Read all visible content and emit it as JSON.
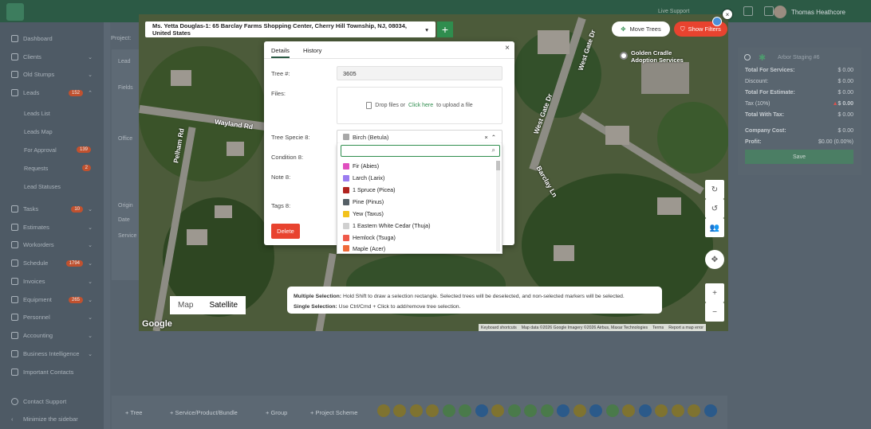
{
  "topbar": {
    "live_support": "Live Support",
    "user_name": "Thomas Heathcore"
  },
  "sidebar": {
    "items": [
      {
        "label": "Dashboard",
        "icon": "grid-icon"
      },
      {
        "label": "Clients",
        "icon": "users-icon"
      },
      {
        "label": "Old Stumps",
        "icon": "stump-icon"
      },
      {
        "label": "Leads",
        "icon": "user-add-icon",
        "badge": "152"
      },
      {
        "label": "Tasks",
        "icon": "checkbox-icon",
        "badge": "10"
      },
      {
        "label": "Estimates",
        "icon": "dollar-icon"
      },
      {
        "label": "Workorders",
        "icon": "users-icon"
      },
      {
        "label": "Schedule",
        "icon": "calendar-icon",
        "badge": "1794"
      },
      {
        "label": "Invoices",
        "icon": "dollar-icon"
      },
      {
        "label": "Equipment",
        "icon": "truck-icon",
        "badge": "265"
      },
      {
        "label": "Personnel",
        "icon": "person-icon"
      },
      {
        "label": "Accounting",
        "icon": "accounting-icon"
      },
      {
        "label": "Business Intelligence",
        "icon": "bulb-icon"
      },
      {
        "label": "Important Contacts",
        "icon": "phone-icon"
      }
    ],
    "leads_sub": [
      {
        "label": "Leads List"
      },
      {
        "label": "Leads Map"
      },
      {
        "label": "For Approval",
        "badge": "139"
      },
      {
        "label": "Requests",
        "badge": "2"
      },
      {
        "label": "Lead Statuses"
      }
    ],
    "contact_support": "Contact Support",
    "minimize": "Minimize the sidebar"
  },
  "page": {
    "project_label": "Project:",
    "lead_label": "Lead",
    "fields_label": "Fields",
    "office_label": "Office",
    "origin_label": "Origin",
    "date_label": "Date",
    "service_label": "Service"
  },
  "summary": {
    "title": "Arbor Staging #6",
    "rows": [
      {
        "label": "Total For Services:",
        "value": "$ 0.00"
      },
      {
        "label": "Discount:",
        "value": "$ 0.00"
      },
      {
        "label": "Total For Estimate:",
        "value": "$ 0.00"
      },
      {
        "label": "Tax (10%)",
        "value": "$ 0.00"
      },
      {
        "label": "Total With Tax:",
        "value": "$ 0.00"
      },
      {
        "label": "Company Cost:",
        "value": "$ 0.00"
      },
      {
        "label": "Profit:",
        "value": "$0.00 (0.00%)"
      }
    ],
    "save_label": "Save"
  },
  "bottombar": {
    "buttons": [
      {
        "label": "Tree"
      },
      {
        "label": "Service/Product/Bundle"
      },
      {
        "label": "Group"
      },
      {
        "label": "Project Scheme"
      }
    ]
  },
  "map": {
    "address": "Ms. Yetta Douglas-1: 65 Barclay Farms Shopping Center, Cherry Hill Township, NJ, 08034, United States",
    "move_trees_label": "Move Trees",
    "show_filters_label": "Show Filters",
    "labels": [
      "Wayland Rd",
      "Pelham Rd",
      "West Gate Dr",
      "West Gate Dr",
      "Barclay Ln",
      "Golden Cradle Adoption Services"
    ],
    "map_type": {
      "map_label": "Map",
      "satellite_label": "Satellite",
      "selected": "Satellite"
    },
    "hint_line1_prefix": "Multiple Selection:",
    "hint_line1": "Hold Shift to draw a selection rectangle. Selected trees will be deselected, and non-selected markers will be selected.",
    "hint_line2_prefix": "Single Selection:",
    "hint_line2": "Use Ctrl/Cmd + Click to add/remove tree selection.",
    "attribution": [
      "Keyboard shortcuts",
      "Map data ©2026 Google Imagery ©2026 Airbus, Maxar Technologies",
      "Terms",
      "Report a map error"
    ],
    "google_logo": "Google"
  },
  "dialog": {
    "tabs": [
      {
        "label": "Details"
      },
      {
        "label": "History"
      }
    ],
    "tree_number_label": "Tree #:",
    "tree_number_value": "3605",
    "files_label": "Files:",
    "drop_text": "Drop files or",
    "click_here": "Click here",
    "upload_text": "to upload a file",
    "specie_label": "Tree Specie 8:",
    "condition_label": "Condition 8:",
    "note_label": "Note 8:",
    "tags_label": "Tags 8:",
    "delete_label": "Delete",
    "selected_specie": {
      "label": "Birch (Betula)",
      "color": "#a8a8a8"
    },
    "search_value": "",
    "options": [
      {
        "label": "Fir (Abies)",
        "color": "#e04fbf"
      },
      {
        "label": "Larch (Larix)",
        "color": "#9b7cf0"
      },
      {
        "label": "1 Spruce (Picea)",
        "color": "#b0231f"
      },
      {
        "label": "Pine (Pinus)",
        "color": "#555f66"
      },
      {
        "label": "Yew (Taxus)",
        "color": "#f2c21b"
      },
      {
        "label": "1 Eastern White Cedar (Thuja)",
        "color": "#d0d0d0"
      },
      {
        "label": "Hemlock (Tsuga)",
        "color": "#ef5a4a"
      },
      {
        "label": "Maple (Acer)",
        "color": "#ef6a3a"
      }
    ]
  }
}
